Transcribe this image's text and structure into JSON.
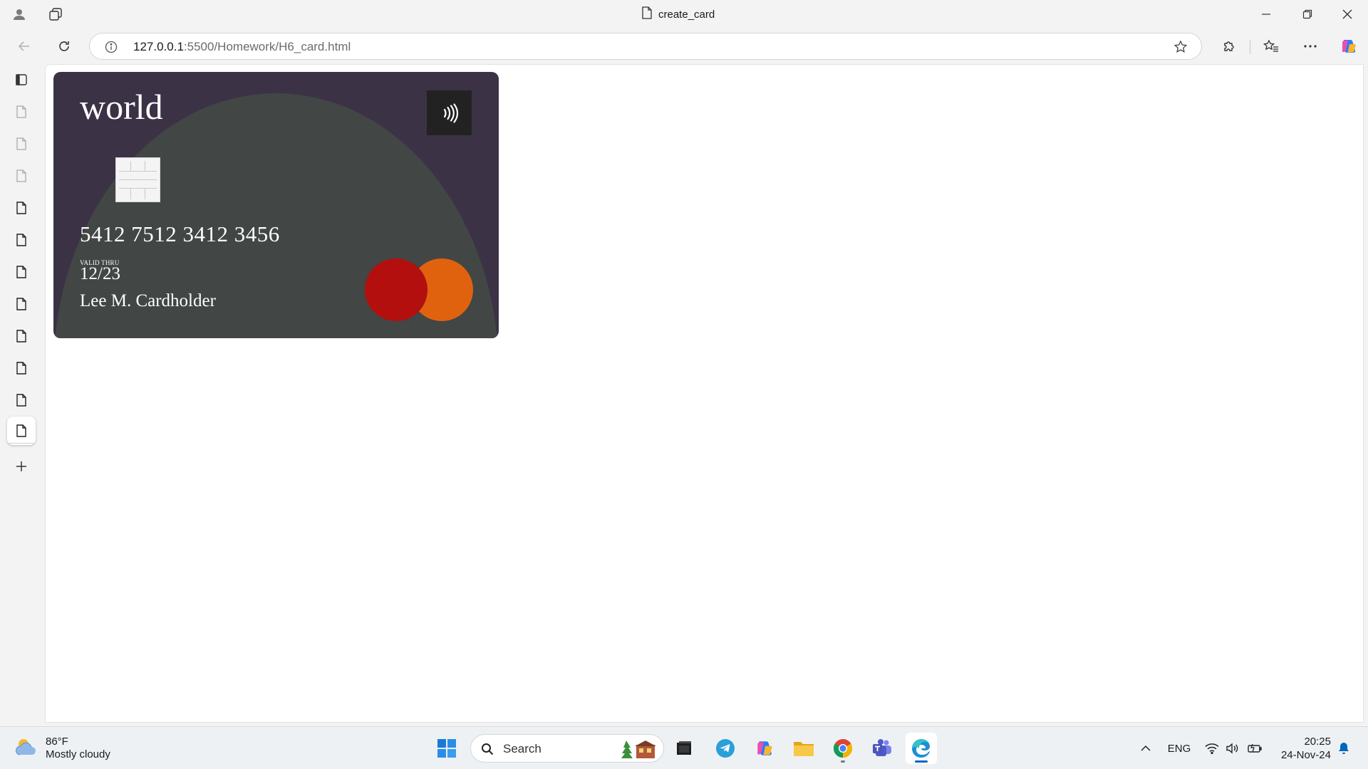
{
  "window": {
    "title": "create_card"
  },
  "addressbar": {
    "url_host": "127.0.0.1",
    "url_path": ":5500/Homework/H6_card.html"
  },
  "sidebar": {
    "tab_count": 12,
    "active_tab_index": 11
  },
  "card": {
    "brand": "world",
    "number": "5412 7512 3412 3456",
    "valid_label": "VALID THRU",
    "expiry": "12/23",
    "holder": "Lee M. Cardholder",
    "colors": {
      "background": "#3c3245",
      "arc": "#424645",
      "mc_red": "#b30f0f",
      "mc_orange": "#e0620f"
    }
  },
  "taskbar": {
    "weather_temp": "86°F",
    "weather_desc": "Mostly cloudy",
    "search_label": "Search",
    "language": "ENG",
    "time": "20:25",
    "date": "24-Nov-24",
    "apps": [
      "start-icon",
      "search",
      "terminal-icon",
      "telegram-icon",
      "copilot-icon",
      "file-explorer-icon",
      "chrome-icon",
      "teams-icon",
      "edge-icon"
    ]
  },
  "icons": {
    "accent": "#0067c0"
  }
}
